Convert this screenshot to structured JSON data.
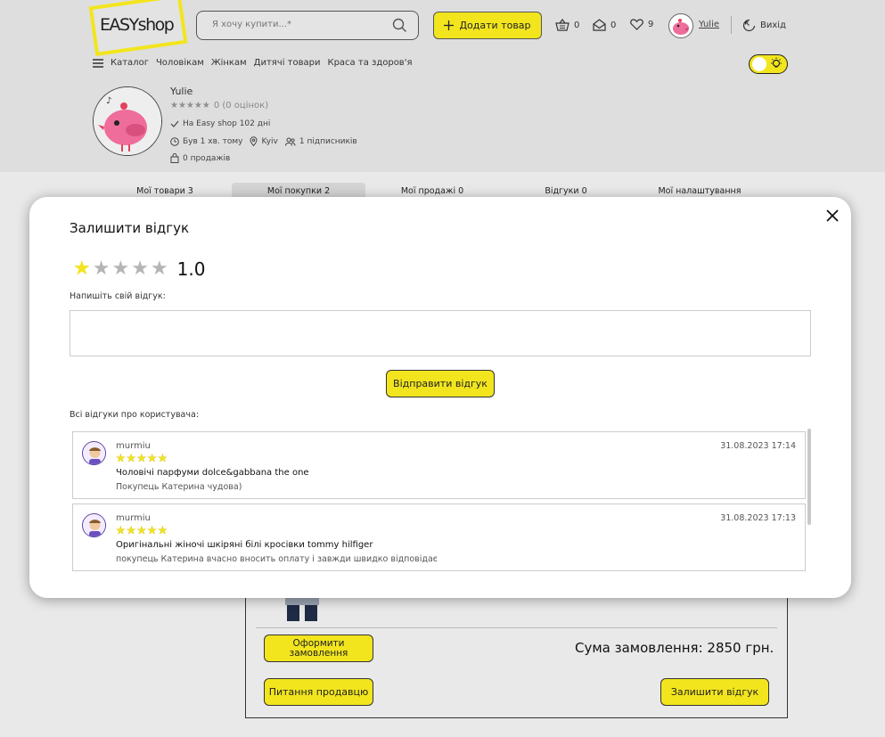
{
  "header": {
    "logo": {
      "part1": "EASY",
      "part2": "shop"
    },
    "search_placeholder": "Я хочу купити...*",
    "add_button": "Додати товар",
    "cart_count": "0",
    "messages_count": "0",
    "favorites_count": "9",
    "user_name": "Yulie",
    "logout": "Вихід"
  },
  "nav": {
    "items": [
      "Каталог",
      "Чоловікам",
      "Жінкам",
      "Дитячі товари",
      "Краса та здоров'я"
    ]
  },
  "profile": {
    "name": "Yulie",
    "rating_text": "0 (0 оцінок)",
    "member_since": "На Easy shop 102 дні",
    "last_seen": "Був 1 хв. тому",
    "city": "Kyiv",
    "followers": "1 підписників",
    "sales": "0 продажів"
  },
  "tabs": [
    {
      "label": "Мої товари 3"
    },
    {
      "label": "Мої покупки 2",
      "active": true
    },
    {
      "label": "Мої продажі 0"
    },
    {
      "label": "Відгуки 0"
    },
    {
      "label": "Мої налаштування"
    }
  ],
  "order": {
    "checkout_button": "Оформити замовлення",
    "sum_label": "Сума замовлення: 2850 грн.",
    "ask_seller_button": "Питання продавцю",
    "leave_review_button": "Залишити відгук"
  },
  "modal": {
    "title": "Залишити відгук",
    "rating_value": "1.0",
    "rating": 1,
    "rating_max": 5,
    "prompt": "Напишіть свій відгук:",
    "textarea_value": "",
    "send_button": "Відправити відгук",
    "all_reviews_label": "Всі відгуки про користувача:",
    "reviews": [
      {
        "author": "murmiu",
        "date": "31.08.2023 17:14",
        "stars": 5,
        "title": "Чоловічі парфуми dolce&gabbana the one",
        "text": "Покупець Катерина чудова)"
      },
      {
        "author": "murmiu",
        "date": "31.08.2023 17:13",
        "stars": 5,
        "title": "Оригінальні жіночі шкіряні білі кросівки tommy hilfiger",
        "text": "покупець Катерина вчасно вносить оплату і завжди швидко відповідає"
      }
    ]
  },
  "colors": {
    "accent": "#f2e51e",
    "background": "#e9e9e9",
    "header_bg": "#dedede"
  }
}
